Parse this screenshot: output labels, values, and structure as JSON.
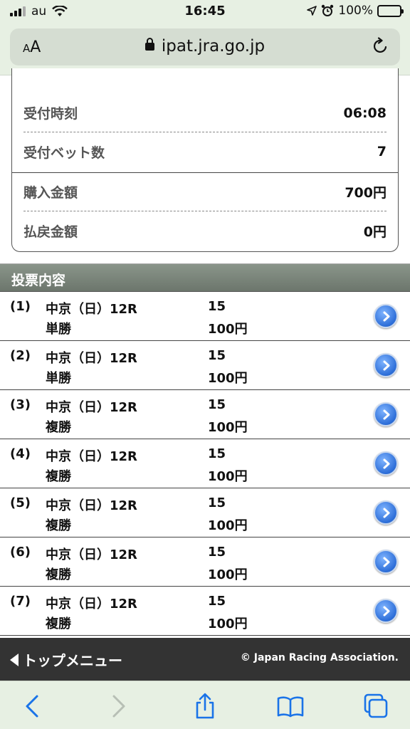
{
  "status_bar": {
    "carrier": "au",
    "time": "16:45",
    "battery": "100%",
    "battery_level": 1.0
  },
  "browser": {
    "aa_label_small": "A",
    "aa_label_large": "A",
    "url": "ipat.jra.go.jp",
    "icons": [
      "wifi-icon",
      "location-icon",
      "alarm-icon",
      "lock-icon",
      "reload-icon",
      "back-icon",
      "forward-icon",
      "share-icon",
      "bookmarks-icon",
      "tabs-icon"
    ]
  },
  "summary": {
    "rows": [
      {
        "label": "受付時刻",
        "value": "06:08"
      },
      {
        "label": "受付ベット数",
        "value": "7"
      },
      {
        "label": "購入金額",
        "value": "700円"
      },
      {
        "label": "払戻金額",
        "value": "0円"
      }
    ]
  },
  "section": {
    "title": "投票内容"
  },
  "bets": [
    {
      "no": "(1)",
      "venue": "中京（日）12R",
      "type": "単勝",
      "horse": "15",
      "amount": "100円"
    },
    {
      "no": "(2)",
      "venue": "中京（日）12R",
      "type": "単勝",
      "horse": "15",
      "amount": "100円"
    },
    {
      "no": "(3)",
      "venue": "中京（日）12R",
      "type": "複勝",
      "horse": "15",
      "amount": "100円"
    },
    {
      "no": "(4)",
      "venue": "中京（日）12R",
      "type": "複勝",
      "horse": "15",
      "amount": "100円"
    },
    {
      "no": "(5)",
      "venue": "中京（日）12R",
      "type": "複勝",
      "horse": "15",
      "amount": "100円"
    },
    {
      "no": "(6)",
      "venue": "中京（日）12R",
      "type": "複勝",
      "horse": "15",
      "amount": "100円"
    },
    {
      "no": "(7)",
      "venue": "中京（日）12R",
      "type": "複勝",
      "horse": "15",
      "amount": "100円"
    }
  ],
  "footer": {
    "back_label": "トップメニュー",
    "copyright": "© Japan Racing Association."
  },
  "colors": {
    "header_bg": "#e7f0e3",
    "section_bg": "#7a847a",
    "footer_bg": "#333333",
    "link_blue": "#2d6ed8",
    "toolbar_icon": "#1a73e8"
  }
}
